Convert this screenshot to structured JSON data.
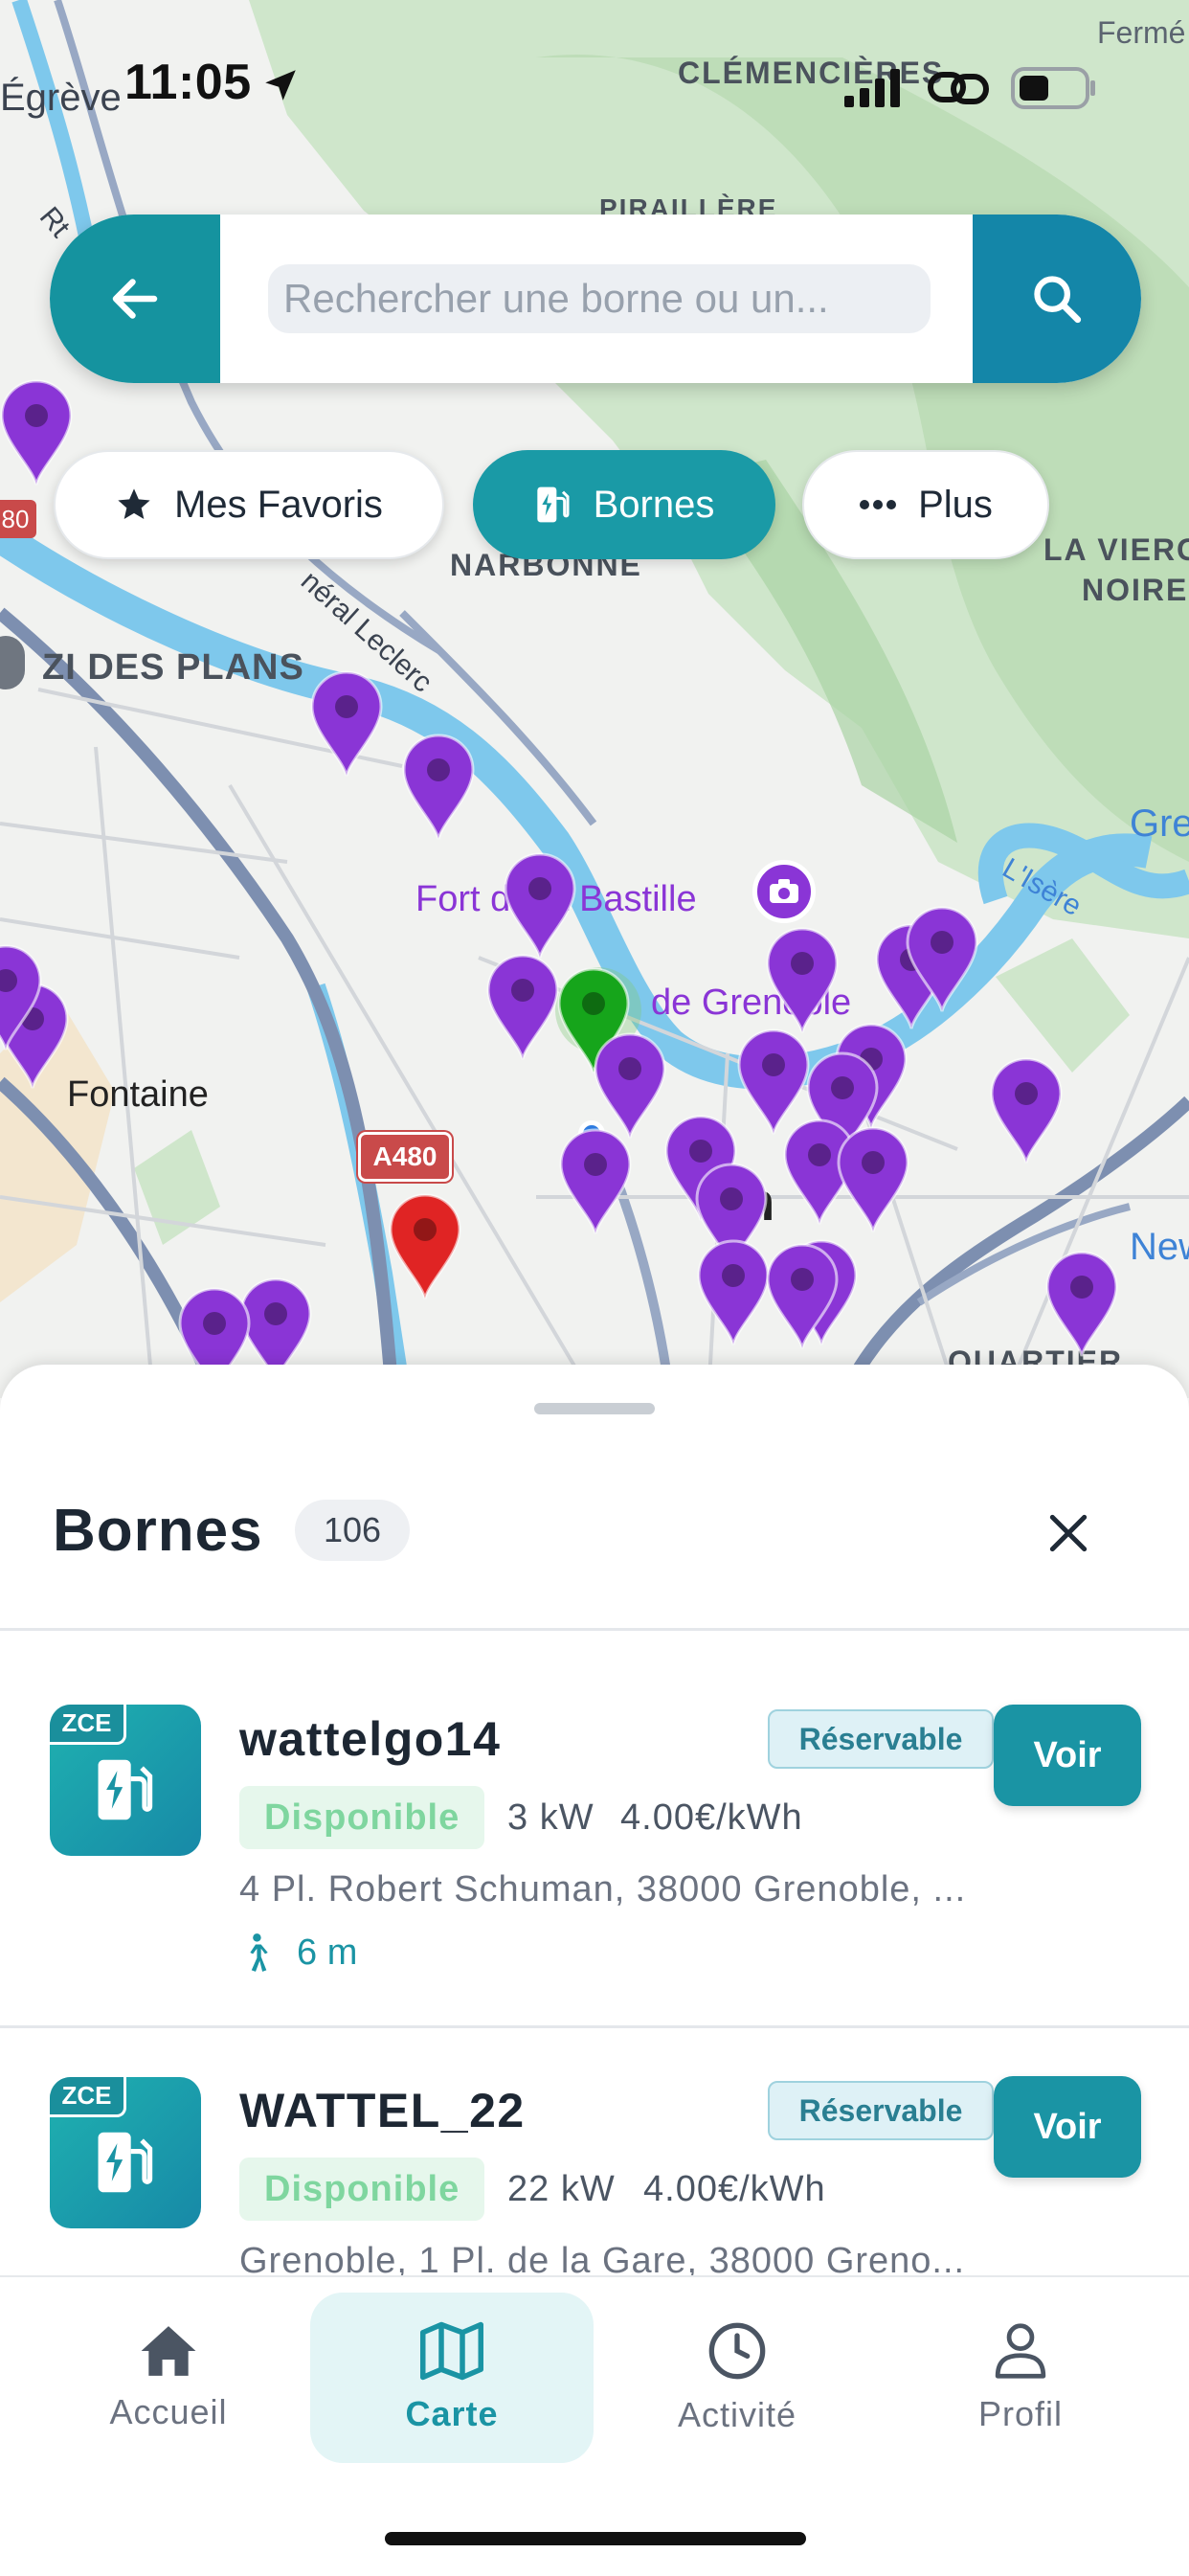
{
  "status_bar": {
    "time": "11:05"
  },
  "map": {
    "labels": {
      "top_right": "Fermé",
      "egreve": "Égrève",
      "clemencieres": "CLÉMENCIÈRES",
      "piraillere": "PIRAILLÈRE",
      "route": "Rt",
      "narbonne": "NARBONNE",
      "la_vierge": "LA VIERG",
      "noire": "NOIRE",
      "general_leclerc": "néral Leclerc",
      "zi_des_plans": "ZI DES PLANS",
      "gre": "Gre",
      "lisere": "L'Isère",
      "fort_bastille": "Fort de la Bastille",
      "de_grenoble": "de Grenoble",
      "fontaine": "Fontaine",
      "a480": "A480",
      "road_80": "80",
      "new": "New",
      "quartier": "QUARTIER",
      "en": "en"
    },
    "colors": {
      "pin_purple": "#8a35d6",
      "pin_green": "#16a51b",
      "pin_red": "#e02424",
      "water": "#7ec8ec",
      "park": "#cde9c8"
    }
  },
  "search": {
    "placeholder": "Rechercher une borne ou un..."
  },
  "filters": {
    "favorites": "Mes Favoris",
    "bornes": "Bornes",
    "plus": "Plus"
  },
  "sheet": {
    "title": "Bornes",
    "count": "106",
    "stations": [
      {
        "tag": "ZCE",
        "name": "wattelgo14",
        "badge": "Réservable",
        "action": "Voir",
        "status": "Disponible",
        "power": "3 kW",
        "price": "4.00€/kWh",
        "address": "4 Pl. Robert Schuman, 38000 Grenoble, ...",
        "distance": "6 m"
      },
      {
        "tag": "ZCE",
        "name": "WATTEL_22",
        "badge": "Réservable",
        "action": "Voir",
        "status": "Disponible",
        "power": "22 kW",
        "price": "4.00€/kWh",
        "address": "Grenoble, 1 Pl. de la Gare, 38000 Greno..."
      }
    ]
  },
  "tabs": [
    {
      "label": "Accueil",
      "icon": "home-icon"
    },
    {
      "label": "Carte",
      "icon": "map-icon"
    },
    {
      "label": "Activité",
      "icon": "clock-icon"
    },
    {
      "label": "Profil",
      "icon": "user-icon"
    }
  ]
}
